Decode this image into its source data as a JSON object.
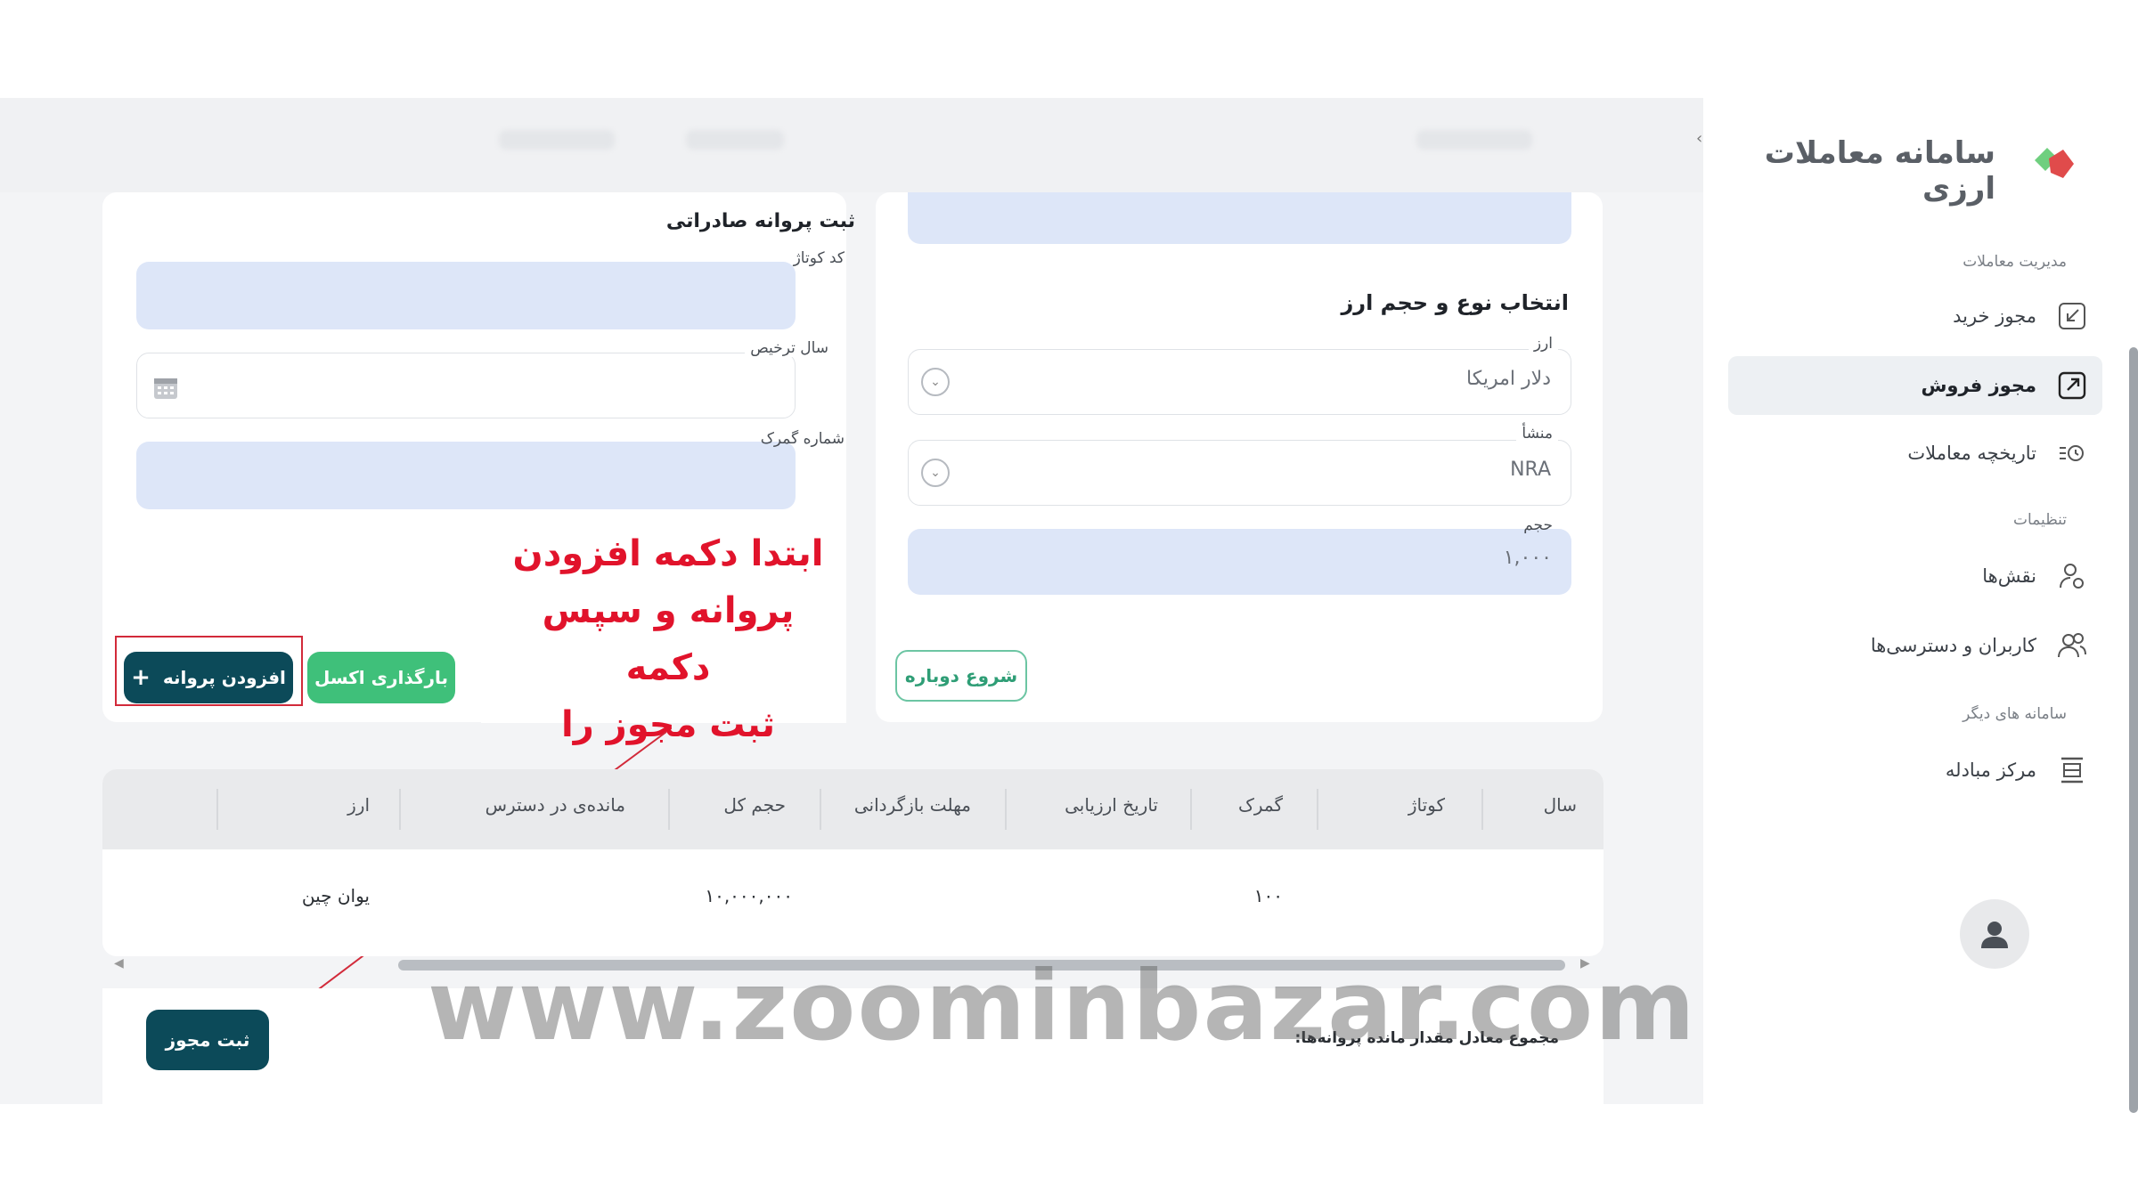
{
  "app": {
    "name": "سامانه معاملات ارزی"
  },
  "sidebar": {
    "sections": [
      {
        "title": "مدیریت معاملات",
        "items": [
          {
            "label": "مجوز خرید",
            "icon": "import-icon",
            "active": false
          },
          {
            "label": "مجوز فروش",
            "icon": "export-icon",
            "active": true
          },
          {
            "label": "تاریخچه معاملات",
            "icon": "history-icon",
            "active": false
          }
        ]
      },
      {
        "title": "تنظیمات",
        "items": [
          {
            "label": "نقش‌ها",
            "icon": "user-role-icon",
            "active": false
          },
          {
            "label": "کاربران و دسترسی‌ها",
            "icon": "users-icon",
            "active": false
          }
        ]
      },
      {
        "title": "سامانه های دیگر",
        "items": [
          {
            "label": "مرکز مبادله",
            "icon": "exchange-center-icon",
            "active": false
          }
        ]
      }
    ]
  },
  "currency_card": {
    "title": "انتخاب نوع و حجم ارز",
    "currency_label": "ارز",
    "currency_value": "دلار امریکا",
    "origin_label": "منشأ",
    "origin_value": "NRA",
    "volume_label": "حجم",
    "volume_value": "۱,۰۰۰",
    "restart_button": "شروع دوباره"
  },
  "license_card": {
    "title": "ثبت پروانه صادراتی",
    "cotage_label": "کد کوتاژ",
    "clearance_year_label": "سال ترخیص",
    "customs_number_label": "شماره گمرک",
    "excel_button": "بارگذاری اکسل",
    "add_license_button": "افزودن پروانه",
    "add_icon": "+"
  },
  "annotation": {
    "lines": [
      "ابتدا دکمه افزودن",
      "پروانه و سپس دکمه",
      "ثبت مجوز را میزنیم"
    ]
  },
  "table": {
    "columns": [
      "سال",
      "کوتاژ",
      "گمرک",
      "تاریخ ارزیابی",
      "مهلت بازگردانی",
      "حجم کل",
      "مانده‌ی در دسترس",
      "ارز"
    ],
    "rows": [
      {
        "customs": "۱۰۰",
        "total_volume": "۱۰,۰۰۰,۰۰۰",
        "currency": "یوان چین"
      }
    ]
  },
  "footer": {
    "total_text": "مجموع معادل مقدار مانده پروانه‌ها:",
    "submit_button": "ثبت مجوز"
  },
  "watermark": "www.zoominbazar.com",
  "colors": {
    "primary_dark": "#0c4a59",
    "green": "#3fc07a",
    "field_fill": "#dde6f8",
    "annotation_red": "#e1132b"
  }
}
